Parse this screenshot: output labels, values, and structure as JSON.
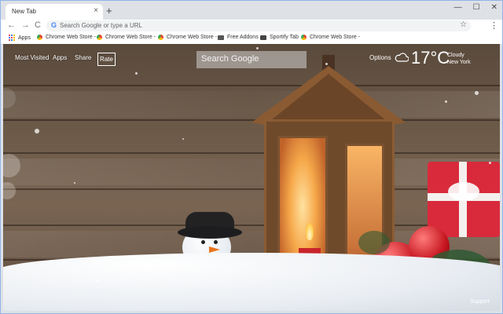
{
  "browser": {
    "tab_title": "New Tab",
    "tab_close": "×",
    "new_tab": "+",
    "window_controls": [
      "—",
      "☐",
      "✕"
    ],
    "omnibox_placeholder": "Search Google or type a URL",
    "bookmarks": [
      {
        "label": "Apps",
        "icon": "apps-grid-icon"
      },
      {
        "label": "Chrome Web Store -",
        "icon": "chrome-web-store-icon"
      },
      {
        "label": "Chrome Web Store -",
        "icon": "chrome-web-store-icon"
      },
      {
        "label": "Chrome Web Store -",
        "icon": "chrome-web-store-icon"
      },
      {
        "label": "Free Addons",
        "icon": "addons-icon"
      },
      {
        "label": "Sportify Tab",
        "icon": "sportify-icon"
      },
      {
        "label": "Chrome Web Store -",
        "icon": "chrome-web-store-icon"
      }
    ]
  },
  "newtab": {
    "nav": {
      "most_visited": "Most Visited",
      "apps": "Apps",
      "share": "Share",
      "rate": "Rate"
    },
    "search_placeholder": "Search Google",
    "options": "Options",
    "weather": {
      "temp": "17°C",
      "condition": "Cloudy",
      "city": "New York",
      "icon": "cloud-icon"
    },
    "support": "Support"
  }
}
